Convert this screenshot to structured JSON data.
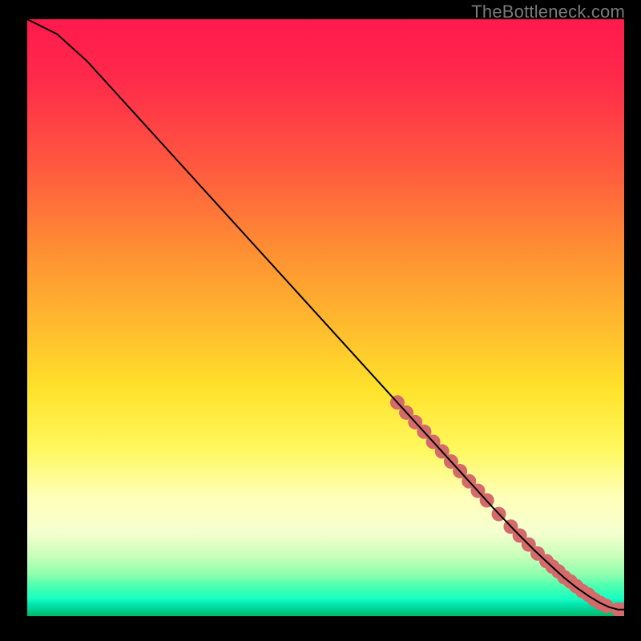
{
  "watermark": "TheBottleneck.com",
  "chart_data": {
    "type": "line",
    "title": "",
    "xlabel": "",
    "ylabel": "",
    "xlim": [
      0,
      100
    ],
    "ylim": [
      0,
      100
    ],
    "grid": false,
    "legend": false,
    "series": [
      {
        "name": "curve",
        "x": [
          0,
          2,
          5,
          10,
          15,
          20,
          30,
          40,
          50,
          60,
          65,
          70,
          74,
          78,
          82,
          85,
          88,
          90,
          92,
          94,
          96,
          97.5,
          99,
          100
        ],
        "y": [
          100,
          99,
          97.5,
          93,
          87.5,
          82,
          71,
          60,
          49,
          38,
          32.5,
          27,
          22.6,
          18.2,
          14,
          11,
          8.2,
          6.4,
          4.8,
          3.4,
          2.2,
          1.5,
          1.1,
          1.1
        ],
        "stroke": "#000000",
        "stroke_width": 2
      }
    ],
    "points": {
      "name": "highlighted-segment",
      "color": "#d46a6a",
      "radius": 9,
      "x": [
        62,
        63.5,
        65,
        66.5,
        68,
        69.5,
        71,
        72.5,
        74,
        75.5,
        77,
        79,
        81,
        82.5,
        84,
        85.5,
        87,
        88,
        89,
        90,
        91,
        92,
        93,
        94,
        95,
        96,
        97,
        99,
        100
      ],
      "y": [
        35.8,
        34.1,
        32.5,
        30.9,
        29.2,
        27.6,
        25.9,
        24.3,
        22.6,
        21.0,
        19.4,
        17.1,
        15.0,
        13.5,
        12.0,
        10.5,
        9.2,
        8.3,
        7.5,
        6.5,
        5.8,
        5.0,
        4.2,
        3.6,
        2.8,
        2.2,
        1.7,
        1.1,
        1.1
      ]
    }
  }
}
